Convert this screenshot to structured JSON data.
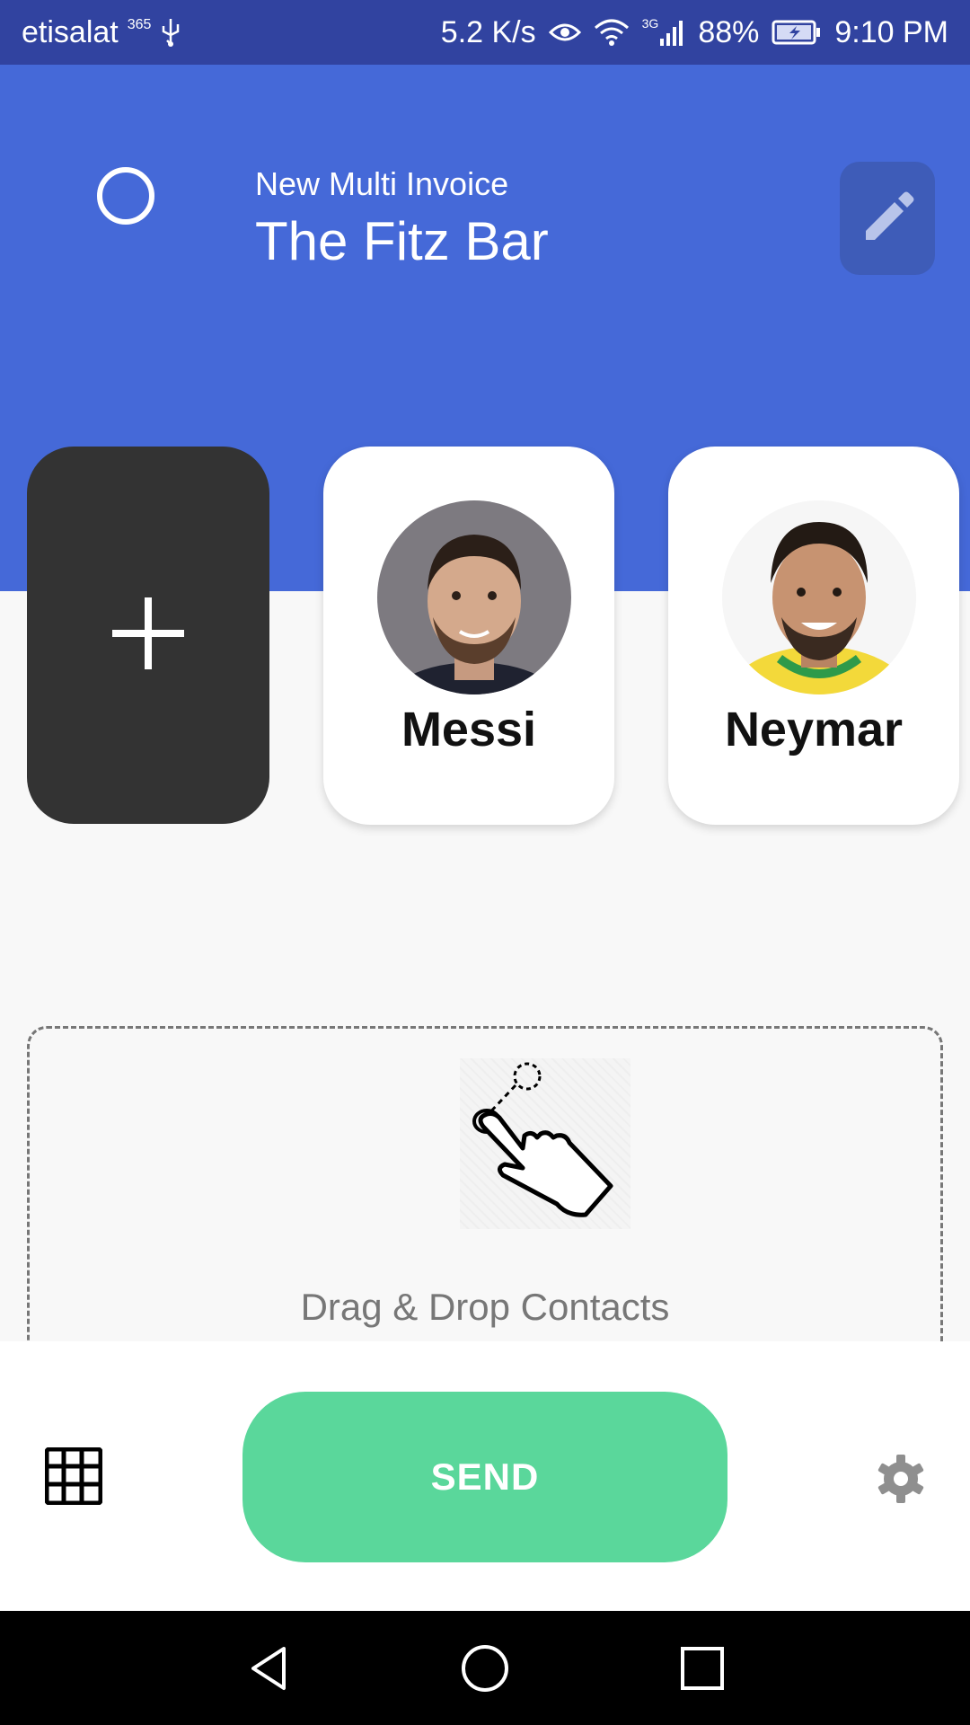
{
  "status_bar": {
    "carrier": "etisalat",
    "carrier_badge": "365",
    "speed": "5.2 K/s",
    "network_type": "3G",
    "battery": "88%",
    "time": "9:10 PM",
    "icons": [
      "usb-icon",
      "eye-icon",
      "wifi-icon",
      "signal-icon",
      "battery-charging-icon"
    ]
  },
  "header": {
    "subtitle": "New Multi Invoice",
    "title": "The Fitz Bar",
    "background_color": "#4569d8"
  },
  "contacts": [
    {
      "name": "Messi"
    },
    {
      "name": "Neymar"
    }
  ],
  "add_card": {
    "icon": "plus-icon"
  },
  "drop_zone": {
    "label": "Drag & Drop Contacts",
    "icon": "drag-hand-icon"
  },
  "bottom_bar": {
    "send_label": "SEND",
    "send_color": "#5ad79b",
    "left_icon": "grid-icon",
    "right_icon": "gear-icon"
  },
  "nav_bar": {
    "icons": [
      "back-icon",
      "home-icon",
      "recents-icon"
    ]
  }
}
